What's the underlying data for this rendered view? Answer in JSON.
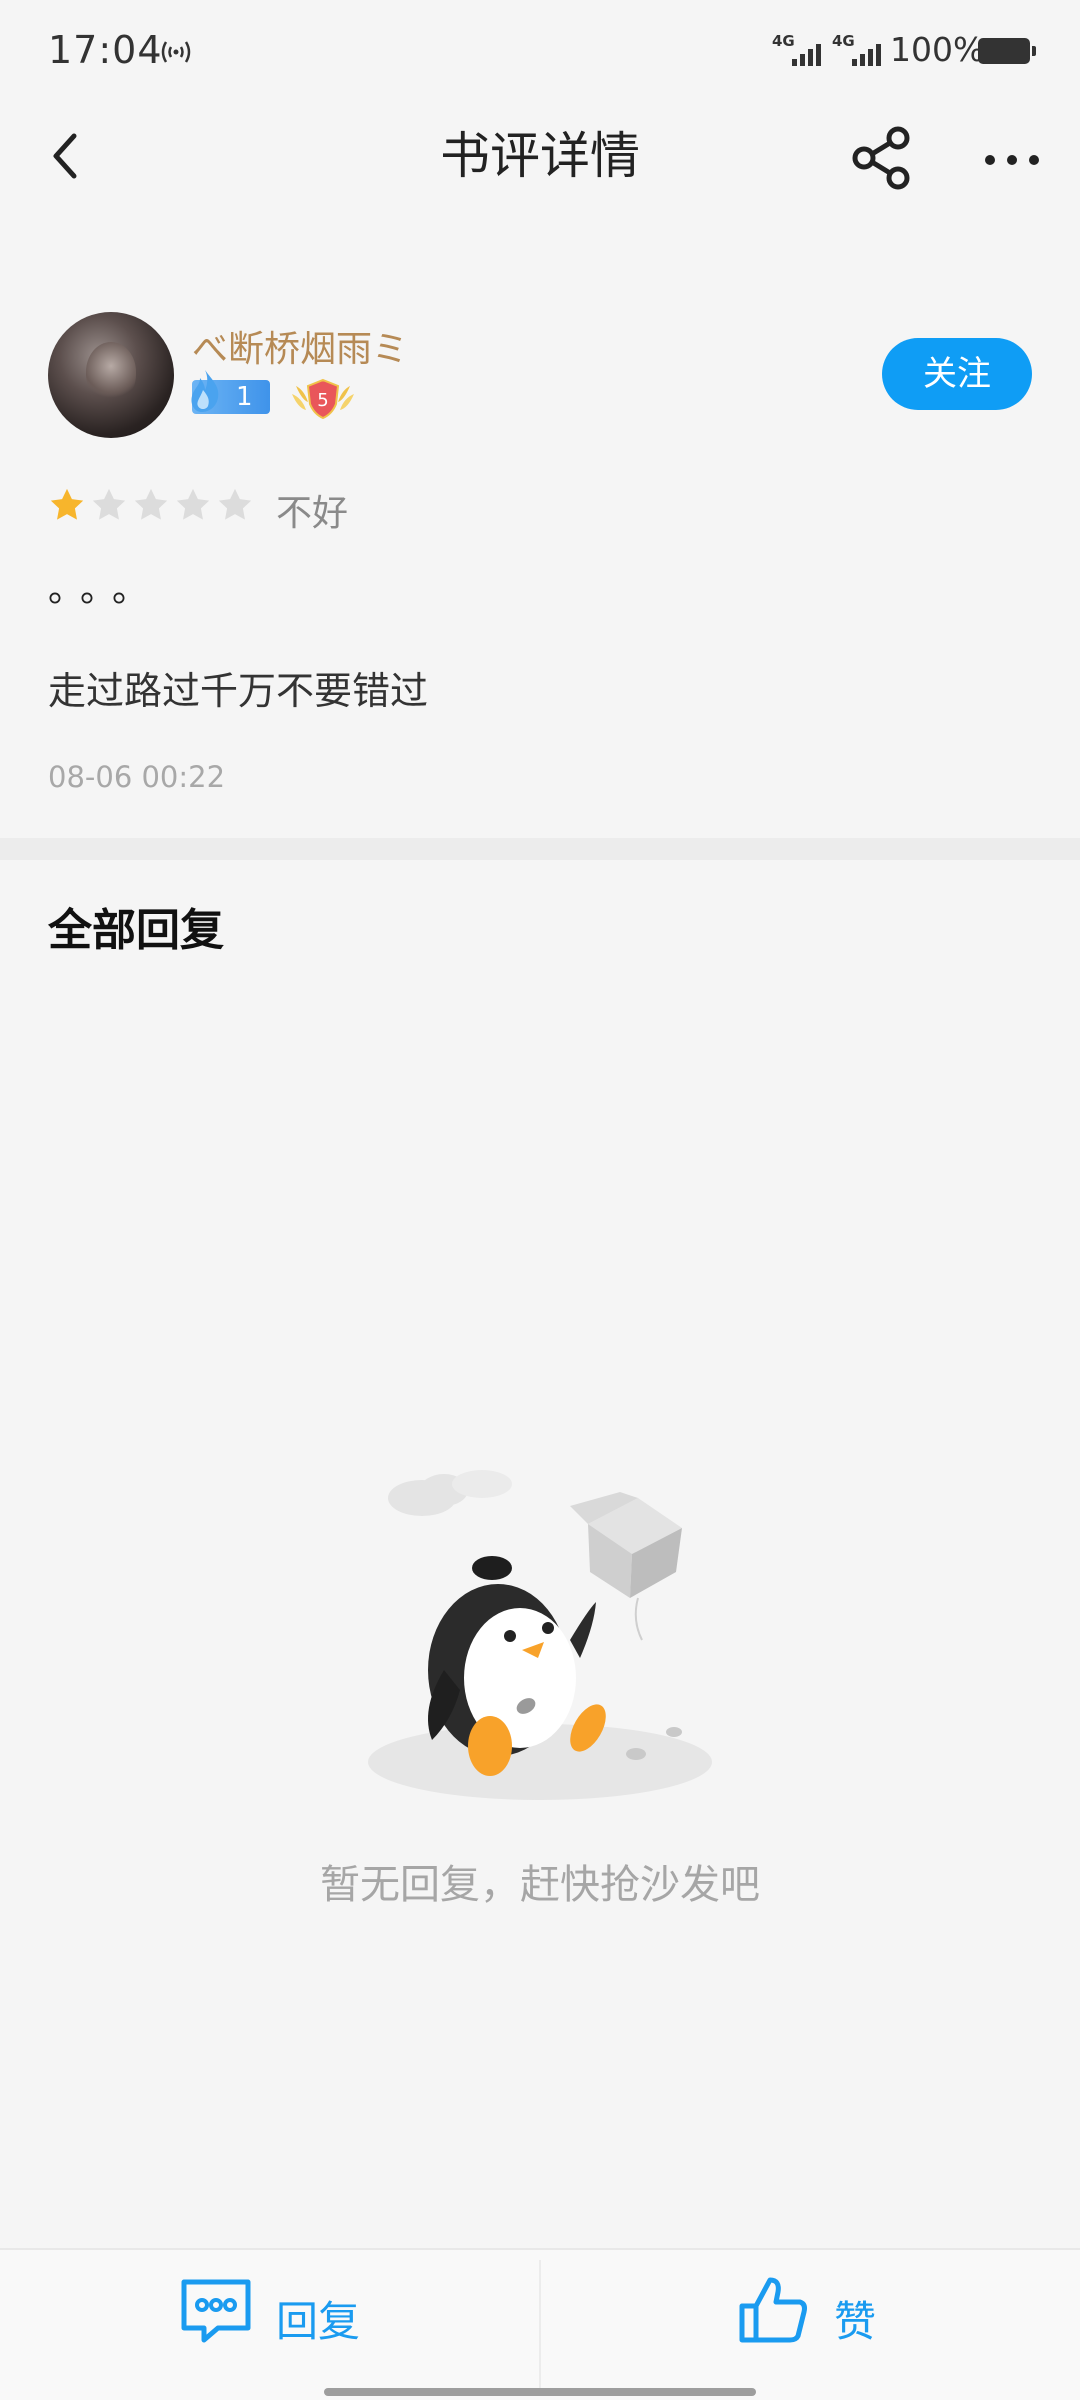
{
  "status_bar": {
    "time": "17:04",
    "signal_1_label": "4G",
    "signal_2_label": "4G",
    "battery": "100%",
    "icons": [
      "hotspot-icon",
      "signal-icon",
      "signal-icon",
      "battery-icon"
    ]
  },
  "nav": {
    "title": "书评详情",
    "icons": [
      "back-arrow-icon",
      "share-icon",
      "more-icon"
    ]
  },
  "review": {
    "author": {
      "name": "べ断桥烟雨ミ",
      "fan_level": "1",
      "rank_level": "5"
    },
    "follow_label": "关注",
    "rating": 1,
    "rating_max": 5,
    "rating_text": "不好",
    "title": "。。。",
    "body": "走过路过千万不要错过",
    "time": "08-06 00:22"
  },
  "replies": {
    "heading": "全部回复",
    "empty_text": "暂无回复，赶快抢沙发吧"
  },
  "bottom_bar": {
    "reply_label": "回复",
    "like_label": "赞"
  },
  "colors": {
    "accent": "#0f9df5",
    "username": "#b68a55",
    "star_active": "#f7b52c",
    "star_inactive": "#dcdcdc",
    "background": "#f5f5f5"
  }
}
